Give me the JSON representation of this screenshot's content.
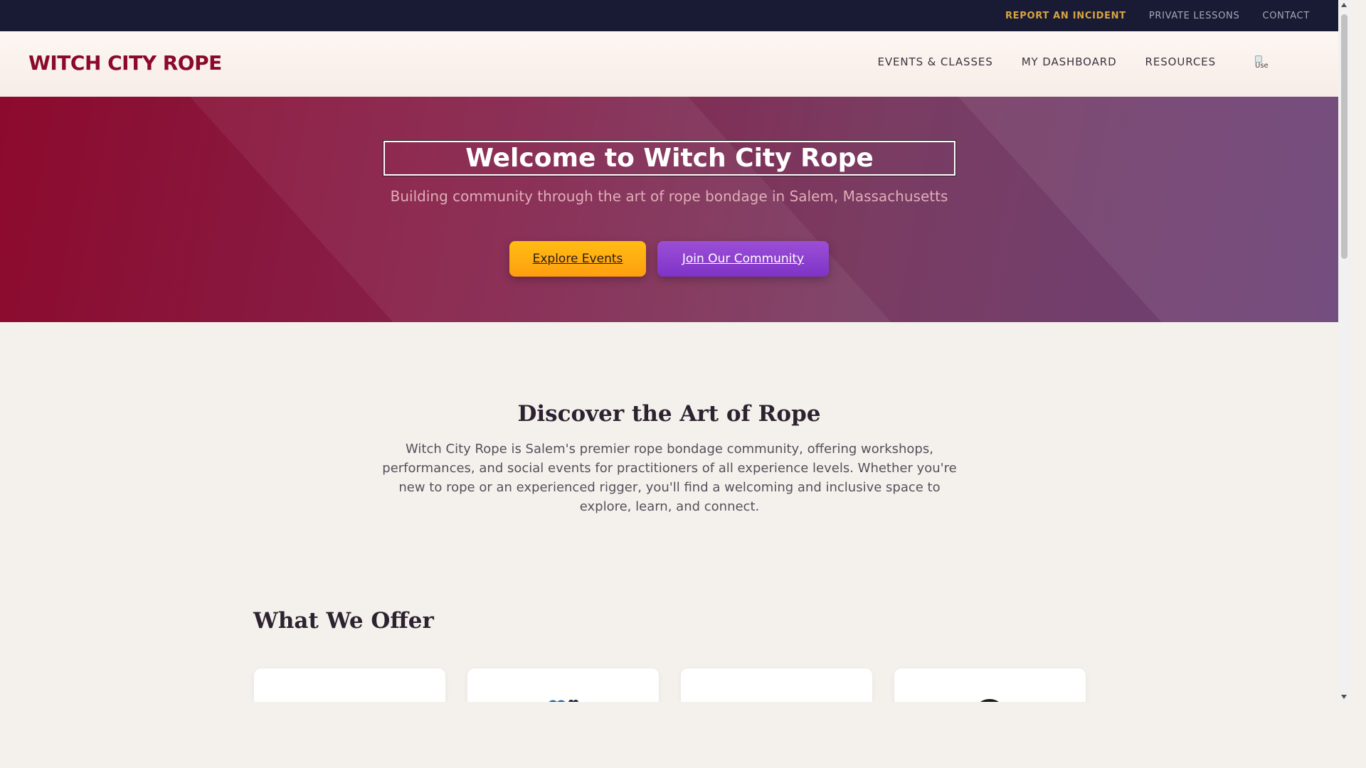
{
  "utility_bar": {
    "report_incident": "REPORT AN INCIDENT",
    "private_lessons": "PRIVATE LESSONS",
    "contact": "CONTACT"
  },
  "header": {
    "logo": "WITCH CITY ROPE",
    "nav": [
      "EVENTS & CLASSES",
      "MY DASHBOARD",
      "RESOURCES"
    ],
    "avatar_alt": "Use"
  },
  "hero": {
    "title": "Welcome to Witch City Rope",
    "subtitle": "Building community through the art of rope bondage in Salem, Massachusetts",
    "primary_button": "Explore Events",
    "secondary_button": "Join Our Community"
  },
  "discover": {
    "title": "Discover the Art of Rope",
    "body": "Witch City Rope is Salem's premier rope bondage community, offering workshops, performances, and social events for practitioners of all experience levels. Whether you're new to rope or an experienced rigger, you'll find a welcoming and inclusive space to explore, learn, and connect."
  },
  "offer": {
    "title": "What We Offer",
    "cards": [
      {
        "icon": "blank-icon"
      },
      {
        "icon": "hearts-icon"
      },
      {
        "icon": "blank-icon"
      },
      {
        "icon": "circle-icon"
      }
    ]
  },
  "colors": {
    "utility_bg": "#191a33",
    "brand": "#8b0a2b",
    "incident": "#d9a441",
    "primary_btn": "#ffb012",
    "secondary_btn": "#8c40cf",
    "page_bg": "#f4f1ed"
  }
}
